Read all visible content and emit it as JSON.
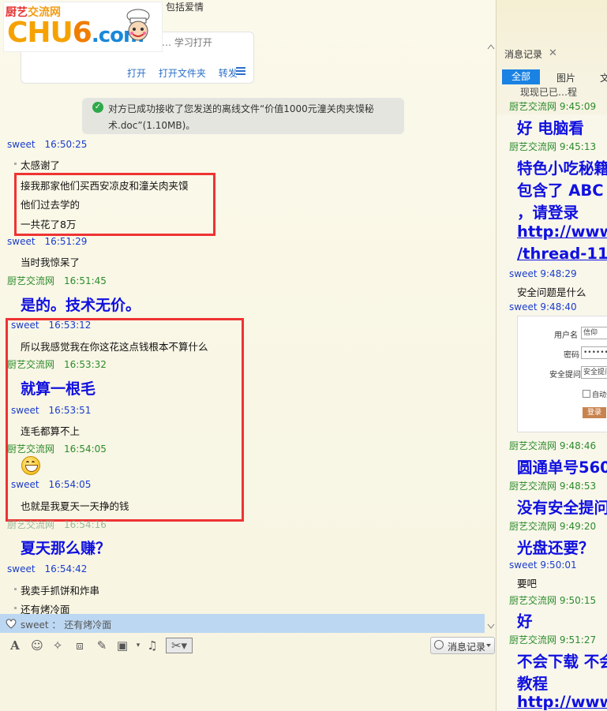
{
  "top_line": "已成功接收…有另一个人还给你，包括爱情",
  "logo": {
    "cn_left": "厨艺",
    "cn_right": "交流网",
    "big_left": "CHU",
    "big_six": "6",
    "big_com": ".com"
  },
  "file_card": {
    "name_partial": "… 学习打开",
    "actions": [
      "打开",
      "打开文件夹",
      "转发"
    ]
  },
  "system_message": "对方已成功接收了您发送的离线文件“价值1000元潼关肉夹馍秘术.doc”(1.10MB)。",
  "chat": [
    {
      "sender": "sweet",
      "time": "16:50:25",
      "kind": "sender",
      "color": "blue"
    },
    {
      "text": "太感谢了",
      "kind": "msg"
    },
    {
      "text": "接我那家他们买西安凉皮和潼关肉夹馍",
      "kind": "msg"
    },
    {
      "text": "他们过去学的",
      "kind": "msg"
    },
    {
      "text": "一共花了8万",
      "kind": "msg"
    },
    {
      "sender": "sweet",
      "time": "16:51:29",
      "kind": "sender",
      "color": "blue"
    },
    {
      "text": "当时我惊呆了",
      "kind": "msg"
    },
    {
      "sender": "厨艺交流网",
      "time": "16:51:45",
      "kind": "sender",
      "color": "green"
    },
    {
      "text": "是的。技术无价。",
      "kind": "big"
    },
    {
      "sender": "sweet",
      "time": "16:53:12",
      "kind": "sender",
      "color": "blue"
    },
    {
      "text": "所以我感觉我在你这花这点钱根本不算什么",
      "kind": "msg"
    },
    {
      "sender": "厨艺交流网",
      "time": "16:53:32",
      "kind": "sender",
      "color": "green"
    },
    {
      "text": "就算一根毛",
      "kind": "big"
    },
    {
      "sender": "sweet",
      "time": "16:53:51",
      "kind": "sender",
      "color": "blue"
    },
    {
      "text": "连毛都算不上",
      "kind": "msg"
    },
    {
      "sender": "厨艺交流网",
      "time": "16:54:05",
      "kind": "sender",
      "color": "green"
    },
    {
      "sender": "sweet",
      "time": "16:54:05",
      "kind": "sender",
      "color": "blue"
    },
    {
      "text": "也就是我夏天一天挣的钱",
      "kind": "msg"
    },
    {
      "sender": "厨艺交流网",
      "time": "16:54:16",
      "kind": "sender",
      "color": "green"
    },
    {
      "text": "夏天那么赚？",
      "kind": "big"
    },
    {
      "sender": "sweet",
      "time": "16:54:42",
      "kind": "sender",
      "color": "blue"
    },
    {
      "text": "我卖手抓饼和炸串",
      "kind": "msg"
    },
    {
      "text": "还有烤冷面",
      "kind": "msg"
    }
  ],
  "preview": {
    "sender": "sweet",
    "sep": "：",
    "text": "还有烤冷面"
  },
  "toolbar": {
    "history_label": "消息记录"
  },
  "history": {
    "title": "消息记录",
    "tabs": [
      "全部",
      "图片",
      "文"
    ],
    "cut_text": "现现已已…程",
    "entries": [
      {
        "sender": "厨艺交流网",
        "time": "9:45:09",
        "color": "green"
      },
      {
        "text": "好  电脑看",
        "kind": "big"
      },
      {
        "sender": "厨艺交流网",
        "time": "9:45:13",
        "color": "green"
      },
      {
        "text": "特色小吃秘籍",
        "kind": "big"
      },
      {
        "text": "包含了 ABC",
        "kind": "big"
      },
      {
        "text": "，请登录",
        "kind": "big"
      },
      {
        "text": "http://www",
        "kind": "link"
      },
      {
        "text": "/thread-11",
        "kind": "link"
      },
      {
        "sender": "sweet",
        "time": "9:48:29",
        "color": "blue"
      },
      {
        "text": "安全问题是什么",
        "kind": "msg"
      },
      {
        "sender": "sweet",
        "time": "9:48:40",
        "color": "blue"
      },
      {
        "sender": "厨艺交流网",
        "time": "9:48:46",
        "color": "green"
      },
      {
        "text": "圆通单号560",
        "kind": "big"
      },
      {
        "sender": "厨艺交流网",
        "time": "9:48:53",
        "color": "green"
      },
      {
        "text": "没有安全提问",
        "kind": "big"
      },
      {
        "sender": "厨艺交流网",
        "time": "9:49:20",
        "color": "green"
      },
      {
        "text": "光盘还要？",
        "kind": "big"
      },
      {
        "sender": "sweet",
        "time": "9:50:01",
        "color": "blue"
      },
      {
        "text": "要吧",
        "kind": "msg"
      },
      {
        "sender": "厨艺交流网",
        "time": "9:50:15",
        "color": "green"
      },
      {
        "text": "好",
        "kind": "big"
      },
      {
        "sender": "厨艺交流网",
        "time": "9:51:27",
        "color": "green"
      },
      {
        "text": "不会下载 不会",
        "kind": "big"
      },
      {
        "text": "教程",
        "kind": "big"
      },
      {
        "text": "http://www",
        "kind": "link"
      }
    ],
    "login_form": {
      "user_label": "用户名",
      "user_value": "信仰",
      "pwd_label": "密码",
      "pwd_value": "••••••",
      "q_label": "安全提问",
      "q_value": "安全提问",
      "auto_label": "自动登",
      "login_btn": "登录"
    }
  }
}
